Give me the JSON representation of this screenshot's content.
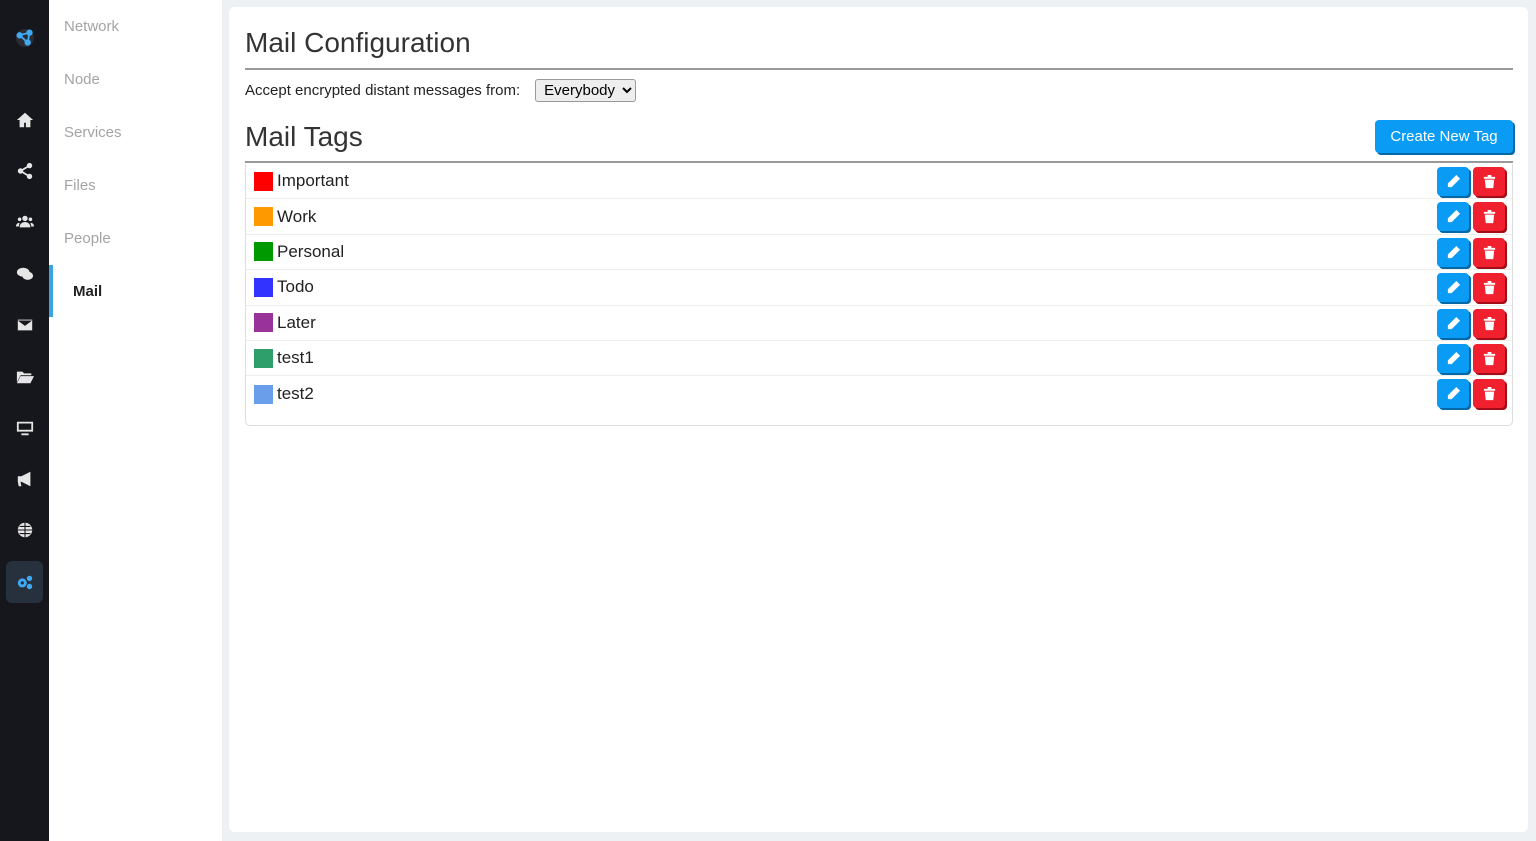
{
  "rail": {
    "icons": [
      "logo-icon",
      "home-icon",
      "share-icon",
      "people-icon",
      "chat-icon",
      "mail-icon",
      "folder-icon",
      "monitor-icon",
      "megaphone-icon",
      "globe-icon",
      "settings-icon"
    ],
    "active": "settings-icon",
    "accent": "#3fa9f5"
  },
  "subnav": {
    "items": [
      {
        "label": "Network"
      },
      {
        "label": "Node"
      },
      {
        "label": "Services"
      },
      {
        "label": "Files"
      },
      {
        "label": "People"
      },
      {
        "label": "Mail",
        "active": true
      }
    ]
  },
  "mail_config": {
    "title": "Mail Configuration",
    "accept_label": "Accept encrypted distant messages from:",
    "accept_value": "Everybody"
  },
  "mail_tags": {
    "title": "Mail Tags",
    "create_label": "Create New Tag",
    "tags": [
      {
        "name": "Important",
        "color": "#ff0000"
      },
      {
        "name": "Work",
        "color": "#ff9900"
      },
      {
        "name": "Personal",
        "color": "#009900"
      },
      {
        "name": "Todo",
        "color": "#3333ff"
      },
      {
        "name": "Later",
        "color": "#993399"
      },
      {
        "name": "test1",
        "color": "#2e9e6b"
      },
      {
        "name": "test2",
        "color": "#6a9eea"
      }
    ]
  }
}
